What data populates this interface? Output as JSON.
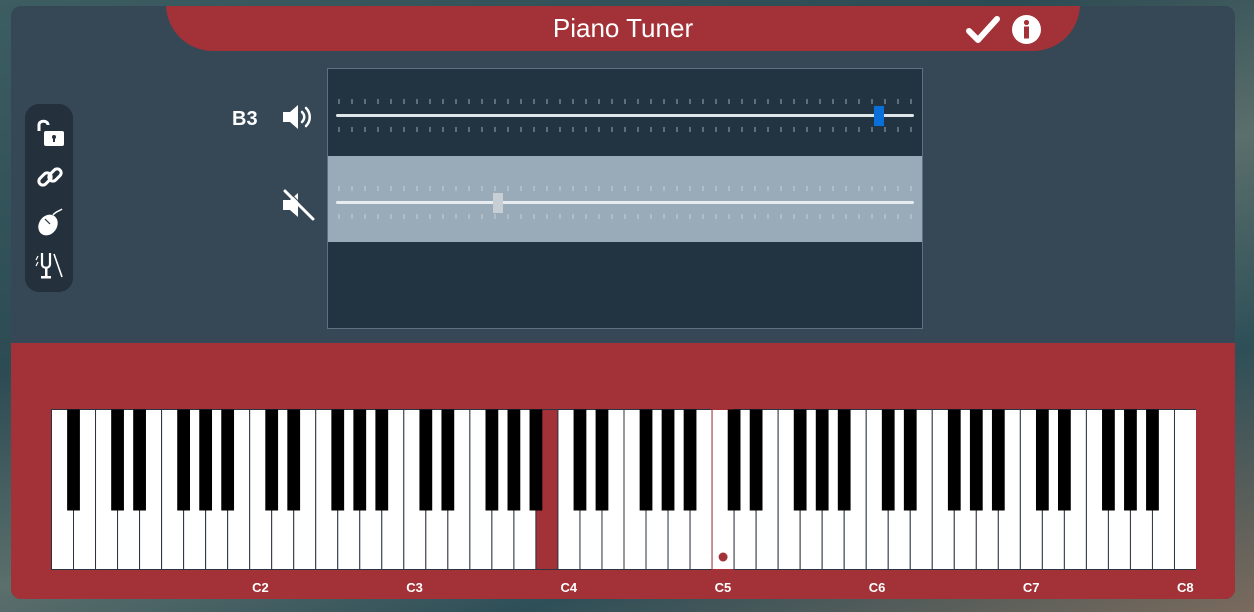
{
  "window": {
    "title": "Piano Tuner"
  },
  "tuner": {
    "current_note": "B3",
    "active_slider_value": 0.94,
    "inactive_slider_value": 0.28
  },
  "keyboard": {
    "octave_labels": [
      "C2",
      "C3",
      "C4",
      "C5",
      "C6",
      "C7",
      "C8"
    ],
    "white_key_count": 52,
    "highlighted_note": "B3",
    "marked_note": "C5"
  },
  "icons": {
    "title_bar": [
      "check-icon",
      "info-icon"
    ],
    "toolbox": [
      "unlock-icon",
      "link-icon",
      "mouse-icon",
      "tuning-fork-icon"
    ],
    "corner": [
      "help-shield-icon",
      "close-icon"
    ]
  },
  "colors": {
    "accent_red": "#a23237",
    "panel": "#364856",
    "slider_active_thumb": "#0a6fd8",
    "slider_inactive_thumb": "#c7cfd4"
  }
}
